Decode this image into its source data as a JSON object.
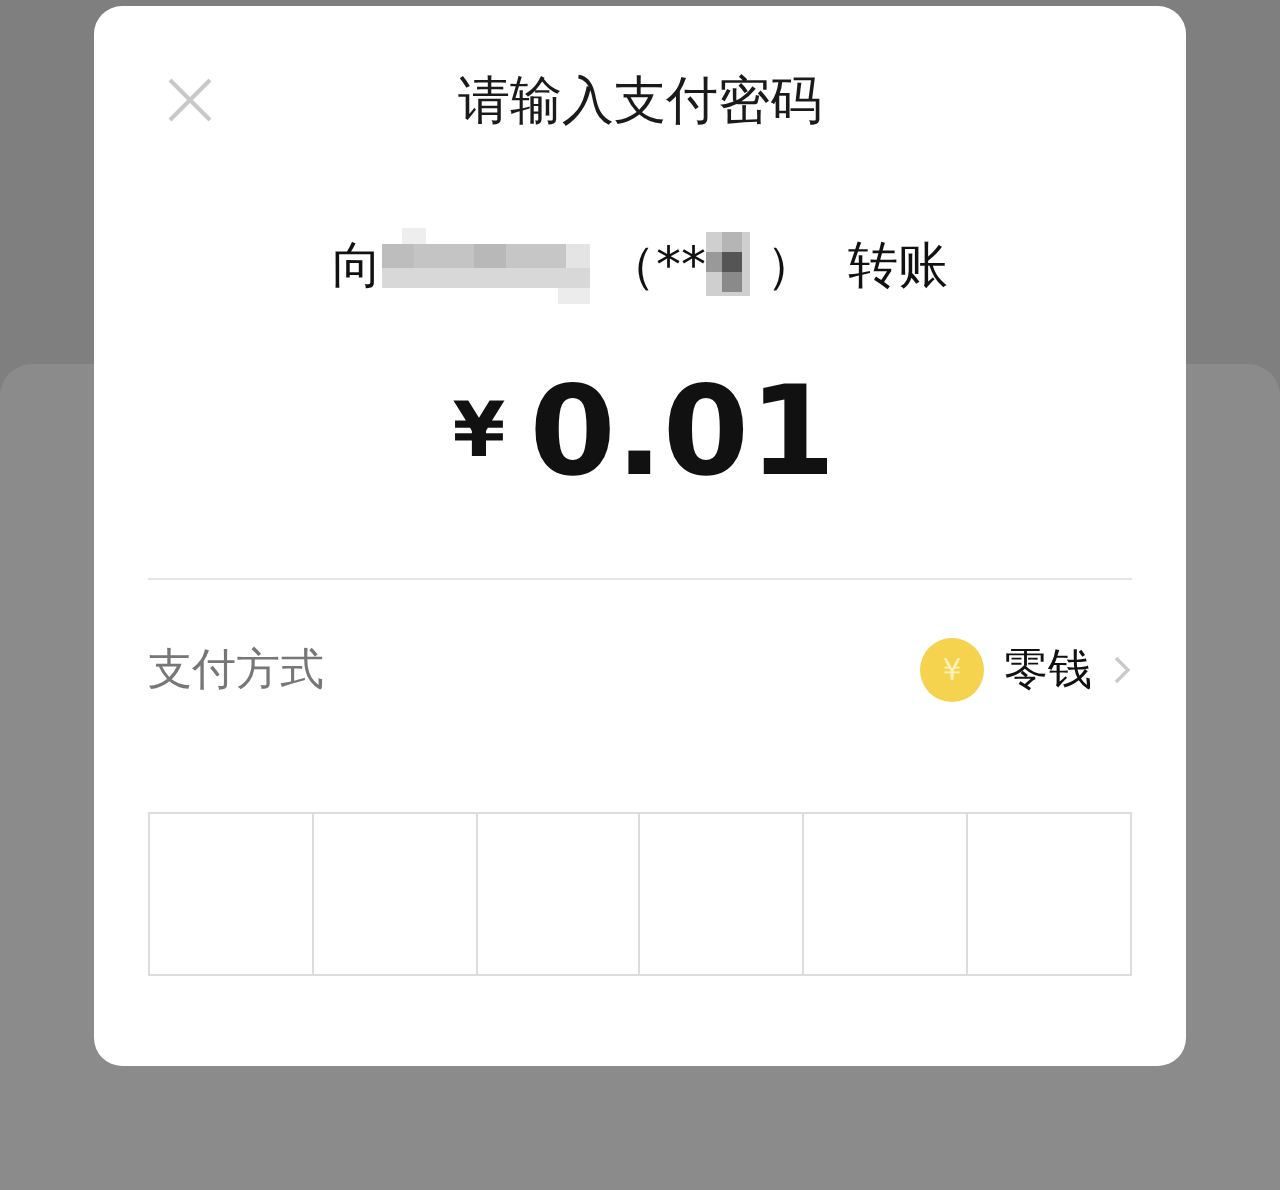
{
  "dialog": {
    "title": "请输入支付密码"
  },
  "recipient": {
    "prefix": "向",
    "name_redacted": true,
    "open_paren": "（**",
    "account_redacted": true,
    "close_paren": "）",
    "suffix": "转账"
  },
  "amount": {
    "currency": "¥",
    "value": "0.01"
  },
  "payment_method": {
    "label": "支付方式",
    "coin_symbol": "¥",
    "value": "零钱"
  },
  "pin_digits": [
    {
      "filled": false
    },
    {
      "filled": false
    },
    {
      "filled": false
    },
    {
      "filled": false
    },
    {
      "filled": false
    },
    {
      "filled": false
    }
  ]
}
